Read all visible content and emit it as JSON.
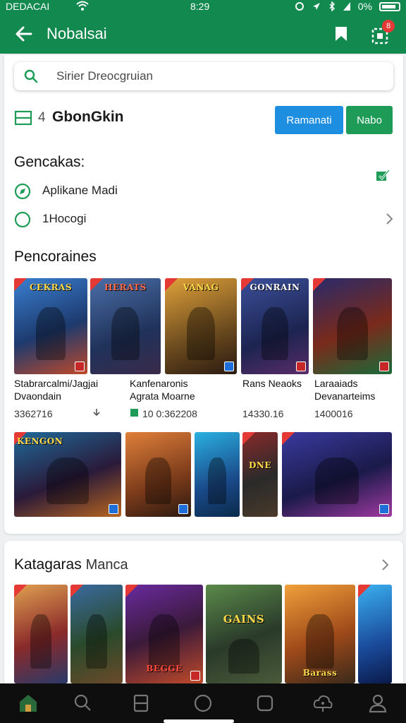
{
  "status_bar": {
    "carrier": "DEDACAI",
    "time": "8:29",
    "battery": "0%"
  },
  "app_bar": {
    "title": "Nobalsai",
    "notification_count": "8"
  },
  "search": {
    "placeholder": "Sirier Dreocgruian"
  },
  "group": {
    "index_label": "4",
    "title": "GbonGkin",
    "primary_button": "Ramanati",
    "secondary_button": "Nabo"
  },
  "settings": {
    "heading": "Gencakas:",
    "options": [
      {
        "label": "Aplikane Madi"
      },
      {
        "label": "1Hocogi"
      }
    ]
  },
  "featured": {
    "heading": "Pencoraines",
    "games": [
      {
        "title_art": "CEKRAS",
        "name": "Stabrarcalmi/Jagjai Dvaondain",
        "meta": "3362716",
        "meta_icon": "download-icon"
      },
      {
        "title_art": "HERATS",
        "name": "Kanfenaronis Agrata Moarne",
        "meta": "10 0:362208",
        "meta_icon": "price-tag-icon"
      },
      {
        "title_art": "VANAG",
        "name": "Rans Neaoks",
        "meta": "14330.16",
        "meta_icon": ""
      },
      {
        "title_art": "GONRAIN",
        "name": "Laraaiads Devanarteims",
        "meta": "1400016",
        "meta_icon": ""
      },
      {
        "title_art": "",
        "name": "",
        "meta": "",
        "meta_icon": ""
      }
    ],
    "row2_titles": [
      "KENGON",
      "",
      "",
      "DNE",
      ""
    ]
  },
  "categories": {
    "heading": "Katagaras",
    "subheading": "Manca",
    "thumb_titles": [
      "",
      "",
      "BEGGE",
      "GAINS",
      "Barass",
      ""
    ]
  },
  "colors": {
    "brand_green": "#12894f",
    "button_blue": "#1e8fe0",
    "button_green": "#1d9b57",
    "nav_bar": "#0e0e0e"
  }
}
